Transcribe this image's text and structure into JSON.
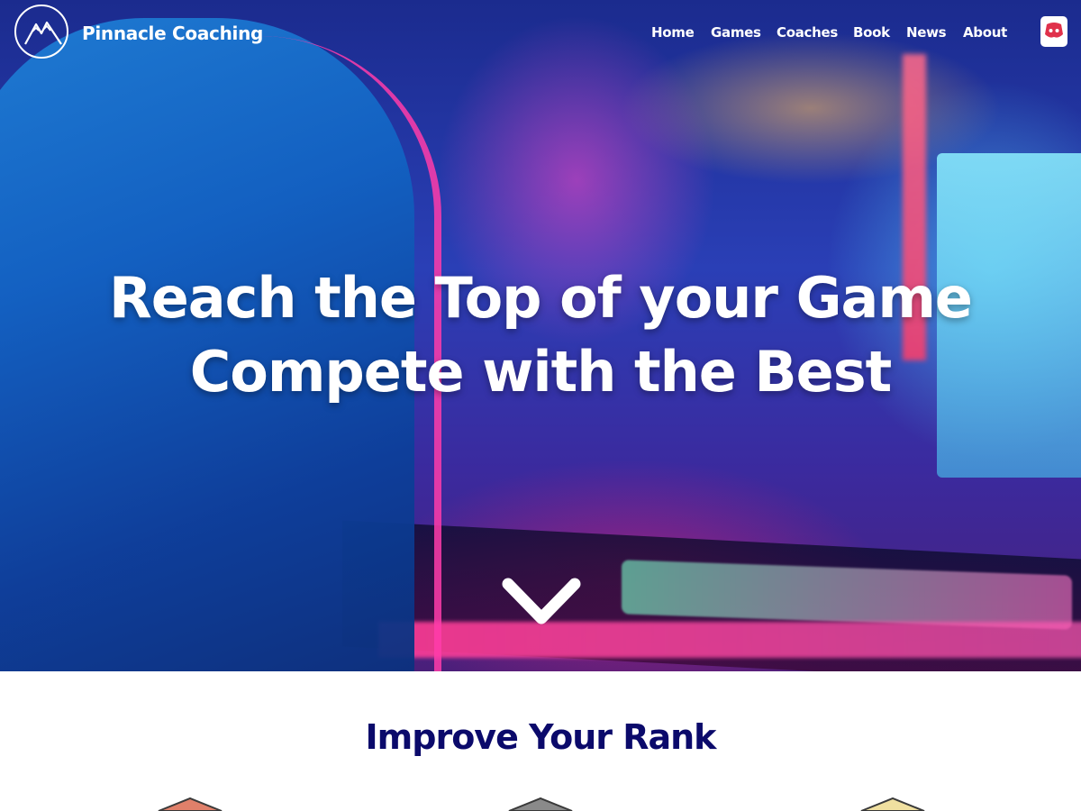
{
  "brand": {
    "name": "Pinnacle Coaching",
    "icon": "mountain-logo-icon"
  },
  "nav": {
    "items": [
      {
        "label": "Home"
      },
      {
        "label": "Games"
      },
      {
        "label": "Coaches"
      },
      {
        "label": "Book"
      },
      {
        "label": "News"
      },
      {
        "label": "About"
      }
    ],
    "social_icon": "discord-icon"
  },
  "hero": {
    "headline_line1": "Reach the Top of your Game",
    "headline_line2": "Compete with the Best",
    "scroll_icon": "chevron-down-icon"
  },
  "section": {
    "title": "Improve Your Rank",
    "badges": [
      {
        "icon": "bronze-rank-badge-icon",
        "color": "#e0806a"
      },
      {
        "icon": "silver-rank-badge-icon",
        "color": "#8a8a8a"
      },
      {
        "icon": "gold-rank-badge-icon",
        "color": "#f0e0a0"
      }
    ]
  },
  "colors": {
    "accent_title": "#0b0a6b",
    "nav_text": "#ffffff"
  }
}
